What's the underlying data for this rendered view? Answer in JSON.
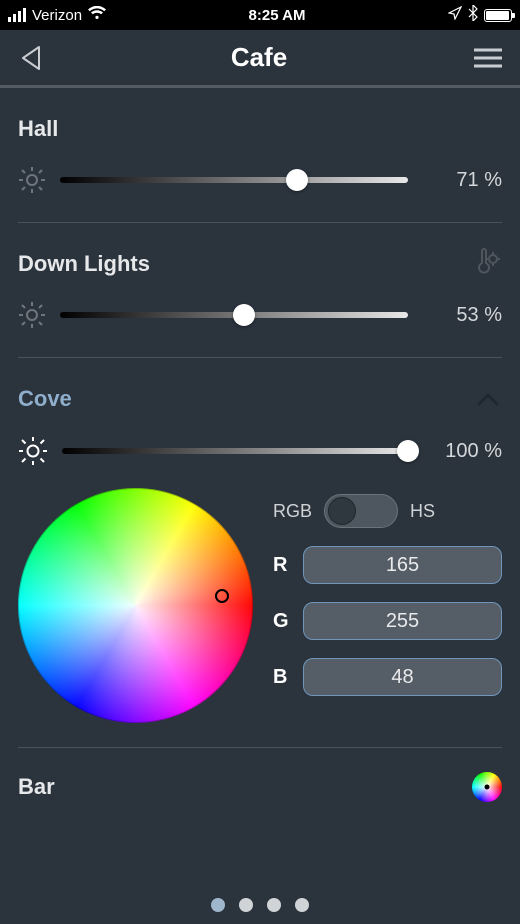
{
  "status_bar": {
    "carrier": "Verizon",
    "time": "8:25 AM",
    "icons": {
      "signal": "signal-4-bars",
      "wifi": "wifi-icon",
      "location": "location-arrow-icon",
      "bluetooth": "bluetooth-icon",
      "battery": "battery-full-icon"
    }
  },
  "nav": {
    "title": "Cafe"
  },
  "zones": [
    {
      "name": "Hall",
      "brightness": 71,
      "unit": "%",
      "expanded": false,
      "has_temperature": false
    },
    {
      "name": "Down Lights",
      "brightness": 53,
      "unit": "%",
      "expanded": false,
      "has_temperature": true
    },
    {
      "name": "Cove",
      "brightness": 100,
      "unit": "%",
      "expanded": true,
      "has_temperature": false,
      "color_mode_labels": {
        "left": "RGB",
        "right": "HS"
      },
      "color_mode": "RGB",
      "rgb": {
        "r_label": "R",
        "g_label": "G",
        "b_label": "B",
        "r": 165,
        "g": 255,
        "b": 48
      },
      "wheel_marker": {
        "x_pct": 87,
        "y_pct": 46
      }
    },
    {
      "name": "Bar",
      "has_color": true
    }
  ],
  "pagination": {
    "count": 4,
    "active_index": 0
  }
}
